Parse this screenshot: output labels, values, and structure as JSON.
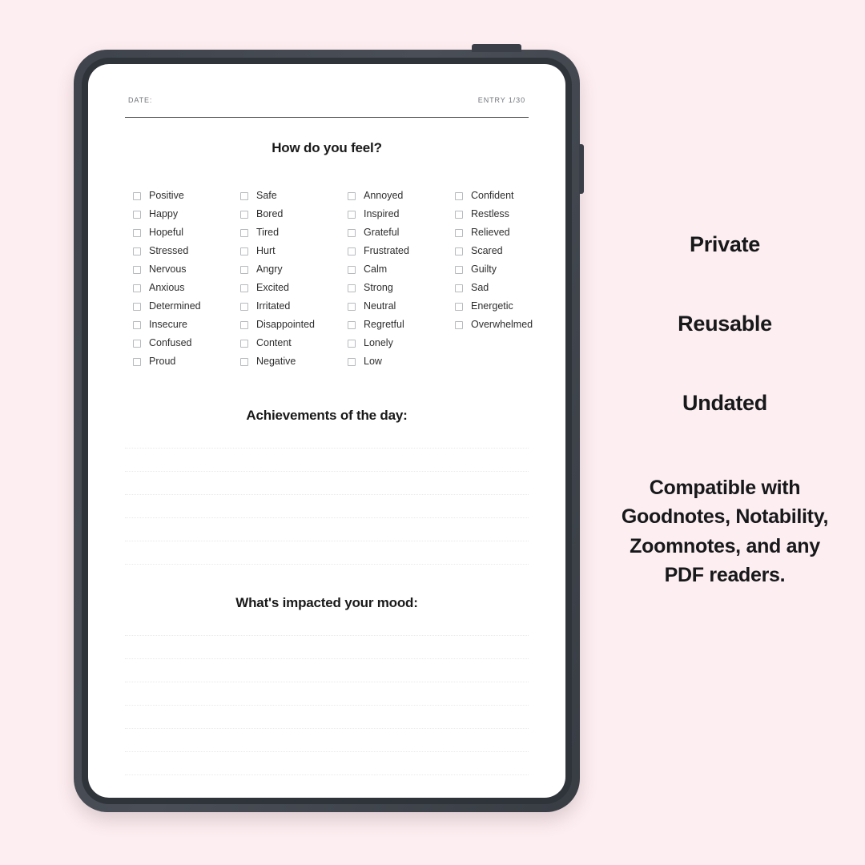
{
  "background_color": "#fdeef1",
  "device": {
    "frame_color": "#3a3f47",
    "power_button_name": "power-button",
    "volume_button_name": "volume-button"
  },
  "journal_page": {
    "header": {
      "date_label": "DATE:",
      "entry_label": "ENTRY 1/30"
    },
    "feelings_section": {
      "heading": "How do you feel?",
      "columns": [
        [
          "Positive",
          "Happy",
          "Hopeful",
          "Stressed",
          "Nervous",
          "Anxious",
          "Determined",
          "Insecure",
          "Confused",
          "Proud"
        ],
        [
          "Safe",
          "Bored",
          "Tired",
          "Hurt",
          "Angry",
          "Excited",
          "Irritated",
          "Disappointed",
          "Content",
          "Negative"
        ],
        [
          "Annoyed",
          "Inspired",
          "Grateful",
          "Frustrated",
          "Calm",
          "Strong",
          "Neutral",
          "Regretful",
          "Lonely",
          "Low"
        ],
        [
          "Confident",
          "Restless",
          "Relieved",
          "Scared",
          "Guilty",
          "Sad",
          "Energetic",
          "Overwhelmed"
        ]
      ]
    },
    "achievements_section": {
      "heading": "Achievements of the day:",
      "line_count": 6
    },
    "mood_impact_section": {
      "heading": "What's impacted your mood:",
      "line_count": 8
    }
  },
  "feature_panel": {
    "words": [
      "Private",
      "Reusable",
      "Undated"
    ],
    "compatibility_note": "Compatible with Goodnotes, Notability, Zoomnotes, and any PDF readers."
  }
}
